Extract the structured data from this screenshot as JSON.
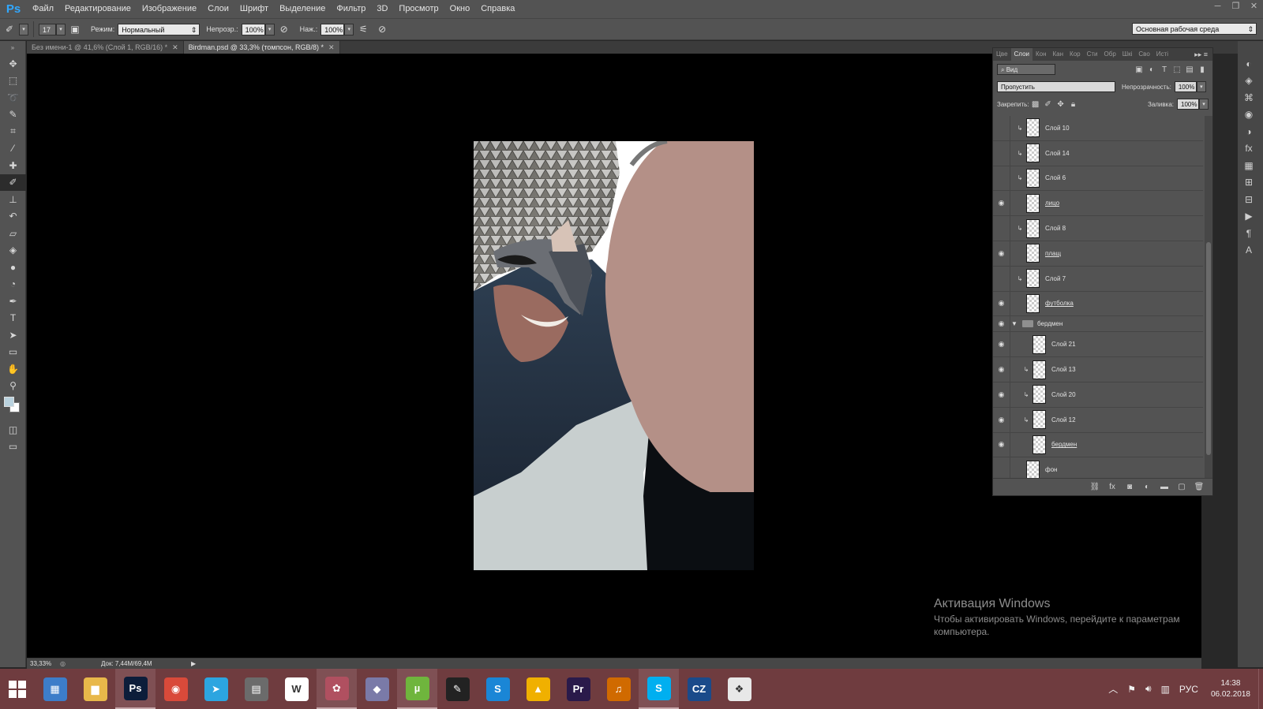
{
  "app": {
    "logo": "Ps",
    "menu": [
      "Файл",
      "Редактирование",
      "Изображение",
      "Слои",
      "Шрифт",
      "Выделение",
      "Фильтр",
      "3D",
      "Просмотр",
      "Окно",
      "Справка"
    ],
    "window_controls": [
      "─",
      "❐",
      "✕"
    ]
  },
  "options": {
    "brush_size": "17",
    "mode_label": "Режим:",
    "mode_value": "Нормальный",
    "opacity_label": "Непрозр.:",
    "opacity_value": "100%",
    "flow_label": "Наж.:",
    "flow_value": "100%",
    "workspace": "Основная рабочая среда"
  },
  "tabs": [
    {
      "label": "Без имени-1 @ 41,6% (Слой 1, RGB/16) *",
      "close": "✕"
    },
    {
      "label": "Birdman.psd @ 33,3% (томпсон, RGB/8) *",
      "close": "✕"
    }
  ],
  "tools": [
    {
      "icon": "move-icon",
      "glyph": "✥"
    },
    {
      "icon": "marquee-icon",
      "glyph": "⬚"
    },
    {
      "icon": "lasso-icon",
      "glyph": "➰"
    },
    {
      "icon": "quick-select-icon",
      "glyph": "✎"
    },
    {
      "icon": "crop-icon",
      "glyph": "⌗"
    },
    {
      "icon": "eyedropper-icon",
      "glyph": "⁄"
    },
    {
      "icon": "healing-icon",
      "glyph": "✚"
    },
    {
      "icon": "brush-icon",
      "glyph": "✐"
    },
    {
      "icon": "stamp-icon",
      "glyph": "⊥"
    },
    {
      "icon": "history-brush-icon",
      "glyph": "↶"
    },
    {
      "icon": "eraser-icon",
      "glyph": "▱"
    },
    {
      "icon": "bucket-icon",
      "glyph": "◈"
    },
    {
      "icon": "blur-icon",
      "glyph": "●"
    },
    {
      "icon": "dodge-icon",
      "glyph": "◔"
    },
    {
      "icon": "pen-icon",
      "glyph": "✒"
    },
    {
      "icon": "type-icon",
      "glyph": "T"
    },
    {
      "icon": "path-select-icon",
      "glyph": "➤"
    },
    {
      "icon": "shape-icon",
      "glyph": "▭"
    },
    {
      "icon": "hand-icon",
      "glyph": "✋"
    },
    {
      "icon": "zoom-icon",
      "glyph": "⚲"
    }
  ],
  "status": {
    "zoom": "33,33%",
    "doc": "Док: 7,44M/69,4M"
  },
  "panel": {
    "tabs": [
      "Цве",
      "Слои",
      "Кон",
      "Кан",
      "Кор",
      "Сти",
      "Обр",
      "Шкі",
      "Сво",
      "Исті"
    ],
    "active_tab": "Слои",
    "menu": "▸▸ ≡",
    "filter_label": "⌕ Вид",
    "blend_mode": "Пропустить",
    "opacity_label": "Непрозрачность:",
    "opacity_value": "100%",
    "lock_label": "Закрепить:",
    "fill_label": "Заливка:",
    "fill_value": "100%"
  },
  "layers": [
    {
      "name": "Слой 10",
      "visible": false,
      "clipped": true,
      "link": false
    },
    {
      "name": "Слой 14",
      "visible": false,
      "clipped": true,
      "link": false
    },
    {
      "name": "Слой 6",
      "visible": false,
      "clipped": true,
      "link": false
    },
    {
      "name": "лицо",
      "visible": true,
      "clipped": false,
      "link": true
    },
    {
      "name": "Слой 8",
      "visible": false,
      "clipped": true,
      "link": false
    },
    {
      "name": "плащ",
      "visible": true,
      "clipped": false,
      "link": true
    },
    {
      "name": "Слой 7",
      "visible": false,
      "clipped": true,
      "link": false
    },
    {
      "name": "футболка",
      "visible": true,
      "clipped": false,
      "link": true
    },
    {
      "name": "бердмен",
      "visible": true,
      "group": true
    },
    {
      "name": "Слой 21",
      "visible": true,
      "clipped": false,
      "link": false,
      "indent": true
    },
    {
      "name": "Слой 13",
      "visible": true,
      "clipped": true,
      "link": false,
      "indent": true
    },
    {
      "name": "Слой 20",
      "visible": true,
      "clipped": true,
      "link": false,
      "indent": true
    },
    {
      "name": "Слой 12",
      "visible": true,
      "clipped": true,
      "link": false,
      "indent": true
    },
    {
      "name": "бердмен",
      "visible": true,
      "clipped": false,
      "link": true,
      "indent": true
    },
    {
      "name": "фон",
      "visible": false,
      "clipped": false,
      "link": false
    }
  ],
  "watermark": {
    "title": "Активация Windows",
    "text": "Чтобы активировать Windows, перейдите к параметрам компьютера."
  },
  "taskbar": {
    "apps": [
      {
        "name": "file-manager",
        "glyph": "▦",
        "color": "#3d7dc9"
      },
      {
        "name": "explorer",
        "glyph": "▆",
        "color": "#e8b84a"
      },
      {
        "name": "photoshop",
        "glyph": "Ps",
        "color": "#0c1d3a",
        "active": true
      },
      {
        "name": "chrome",
        "glyph": "◉",
        "color": "#d94a3a"
      },
      {
        "name": "telegram",
        "glyph": "➤",
        "color": "#2ca5e0"
      },
      {
        "name": "calculator",
        "glyph": "▤",
        "color": "#6b6b6b"
      },
      {
        "name": "wps",
        "glyph": "W",
        "color": "#ffffff"
      },
      {
        "name": "paint",
        "glyph": "✿",
        "color": "#b05060",
        "active": true
      },
      {
        "name": "3d-app",
        "glyph": "◆",
        "color": "#7a7aa8"
      },
      {
        "name": "utorrent",
        "glyph": "µ",
        "color": "#6fb53d",
        "active": true
      },
      {
        "name": "tablet",
        "glyph": "✎",
        "color": "#222222"
      },
      {
        "name": "shazam",
        "glyph": "S",
        "color": "#1a86d6"
      },
      {
        "name": "aimp",
        "glyph": "▲",
        "color": "#f0b000"
      },
      {
        "name": "premiere",
        "glyph": "Pr",
        "color": "#2a1a4a"
      },
      {
        "name": "audio",
        "glyph": "♫",
        "color": "#d06a00"
      },
      {
        "name": "skype",
        "glyph": "S",
        "color": "#00aff0",
        "active": true
      },
      {
        "name": "cz",
        "glyph": "CZ",
        "color": "#1a4a8a"
      },
      {
        "name": "popcorn",
        "glyph": "❖",
        "color": "#e8e8e8"
      }
    ],
    "lang": "РУС",
    "time": "14:38",
    "date": "06.02.2018"
  }
}
